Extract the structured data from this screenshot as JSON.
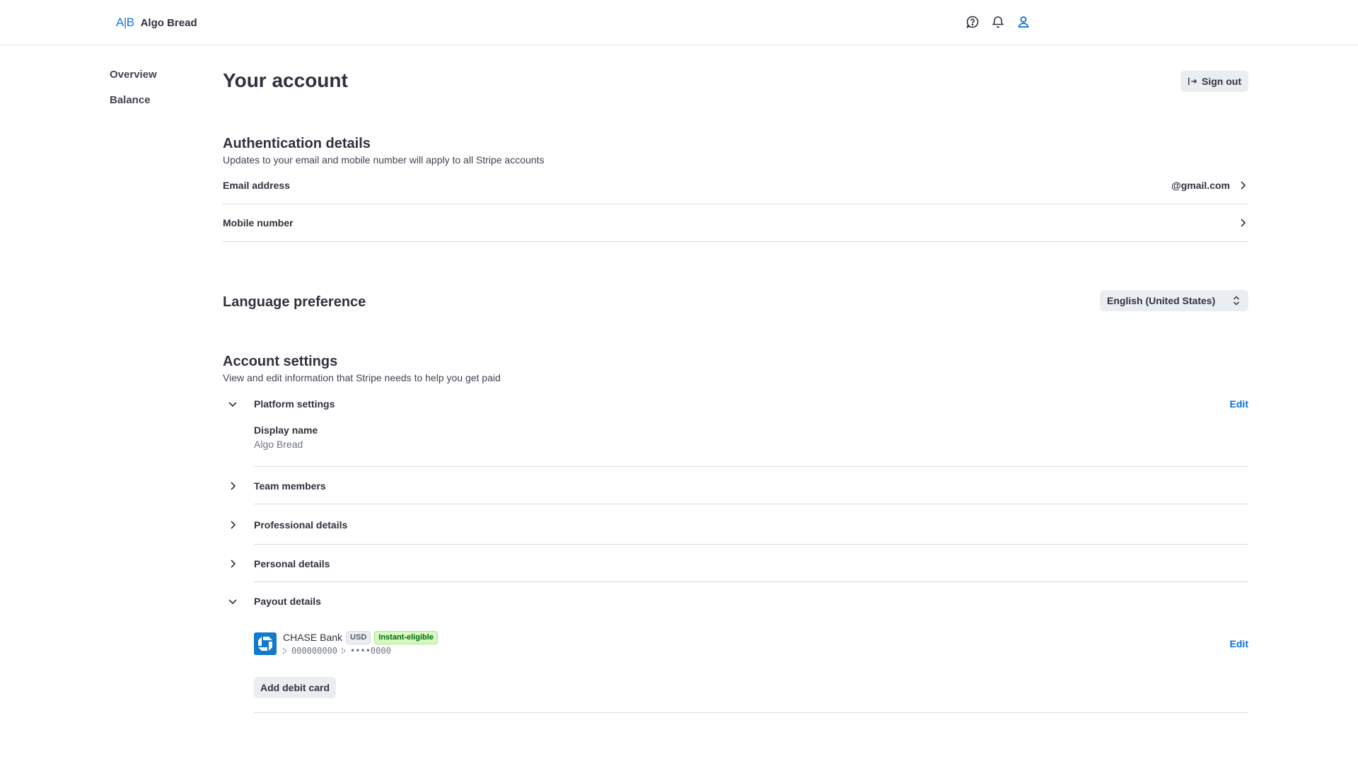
{
  "brand": {
    "logo": "A|B",
    "name": "Algo Bread"
  },
  "topbar": {
    "icons": [
      "help-icon",
      "bell-icon",
      "user-icon"
    ]
  },
  "sidebar": {
    "items": [
      {
        "label": "Overview"
      },
      {
        "label": "Balance"
      }
    ]
  },
  "page": {
    "title": "Your account",
    "signout_label": "Sign out"
  },
  "auth": {
    "title": "Authentication details",
    "subtitle": "Updates to your email and mobile number will apply to all Stripe accounts",
    "email_label": "Email address",
    "email_value": "@gmail.com",
    "mobile_label": "Mobile number"
  },
  "language": {
    "title": "Language preference",
    "selected": "English (United States)"
  },
  "account_settings": {
    "title": "Account settings",
    "subtitle": "View and edit information that Stripe needs to help you get paid",
    "platform": {
      "label": "Platform settings",
      "edit": "Edit",
      "display_name_label": "Display name",
      "display_name_value": "Algo Bread"
    },
    "team_label": "Team members",
    "professional_label": "Professional details",
    "personal_label": "Personal details",
    "payout": {
      "label": "Payout details",
      "edit": "Edit",
      "bank_name": "CHASE Bank",
      "currency_badge": "USD",
      "instant_badge": "Instant-eligible",
      "routing": "000000000",
      "account": "••••0000",
      "add_debit_label": "Add debit card"
    }
  },
  "colors": {
    "link": "#0570de",
    "brand_blue": "#1a73e8",
    "chase_blue": "#117aca",
    "badge_green_bg": "#d7f7c2"
  }
}
